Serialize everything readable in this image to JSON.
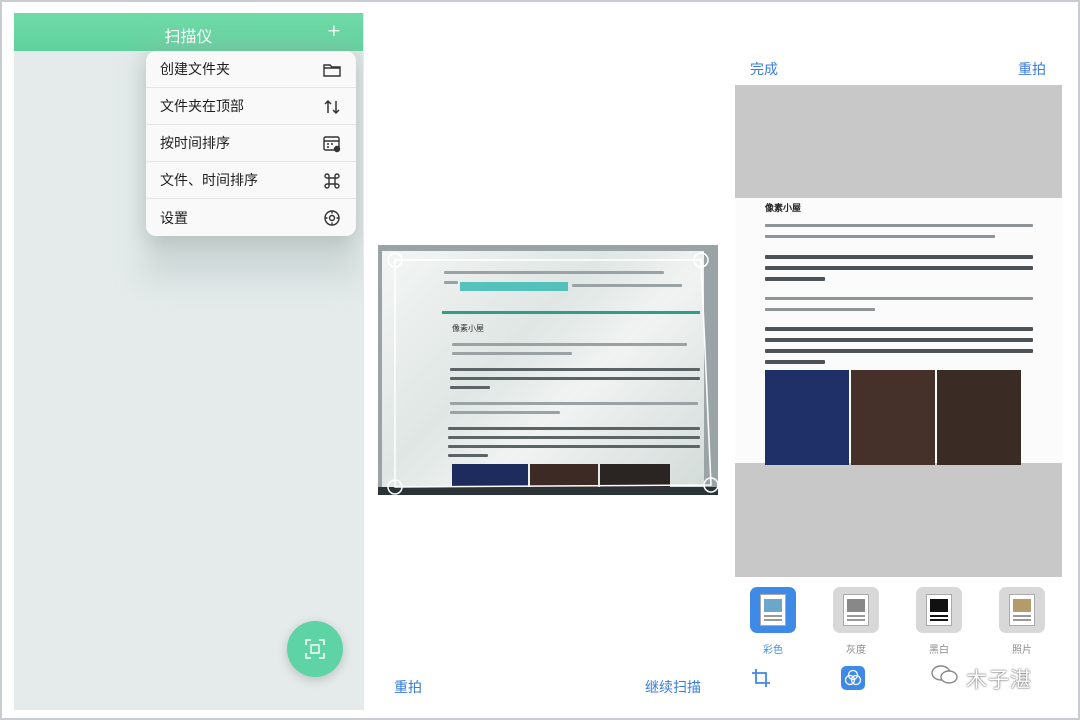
{
  "panel1": {
    "app_title": "扫描仪",
    "plus_icon": "plus-icon",
    "menu": [
      {
        "label": "创建文件夹",
        "icon": "folder-icon"
      },
      {
        "label": "文件夹在顶部",
        "icon": "sort-arrows-icon"
      },
      {
        "label": "按时间排序",
        "icon": "calendar-icon"
      },
      {
        "label": "文件、时间排序",
        "icon": "command-icon"
      },
      {
        "label": "设置",
        "icon": "gear-icon"
      }
    ],
    "fab_icon": "scan-icon",
    "header_color": "#65d5a2",
    "background_color": "#e4ebea"
  },
  "panel2": {
    "retake": "重拍",
    "continue": "继续扫描",
    "doc_heading": "像素小屋",
    "accent": "#3a7dd8"
  },
  "panel3": {
    "done": "完成",
    "retake": "重拍",
    "doc_title": "像素小屋",
    "filters": [
      {
        "label": "彩色",
        "active": true
      },
      {
        "label": "灰度",
        "active": false
      },
      {
        "label": "黑白",
        "active": false
      },
      {
        "label": "照片",
        "active": false
      }
    ],
    "tools": [
      "crop-icon",
      "color-filter-icon"
    ],
    "watermark": "木子湛",
    "active_color": "#3e8ae6"
  }
}
